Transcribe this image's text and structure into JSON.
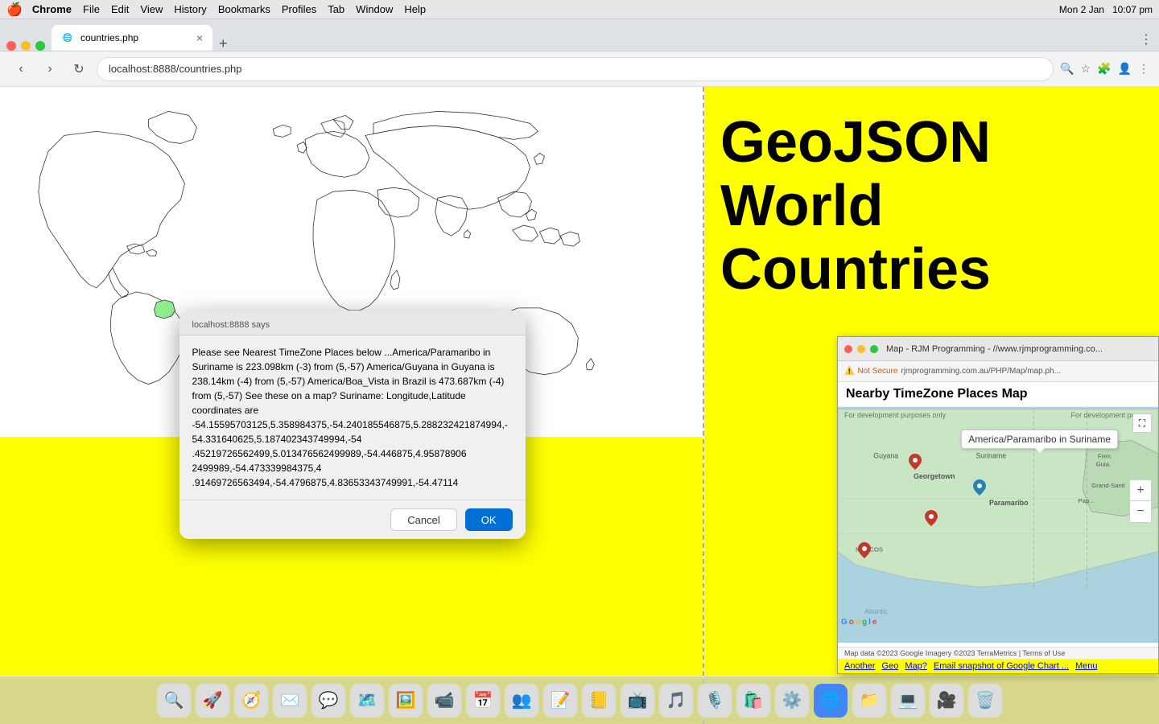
{
  "menubar": {
    "apple": "🍎",
    "items": [
      "Chrome",
      "File",
      "Edit",
      "View",
      "History",
      "Bookmarks",
      "Profiles",
      "Tab",
      "Window",
      "Help"
    ],
    "right": [
      "Mon 2 Jan",
      "10:07 pm"
    ]
  },
  "chrome": {
    "tab": {
      "title": "countries.php",
      "url": "localhost:8888/countries.php"
    },
    "new_tab_label": "+",
    "nav": {
      "back": "‹",
      "forward": "›",
      "reload": "↻"
    }
  },
  "geojson": {
    "title_line1": "GeoJSON",
    "title_line2": "World",
    "title_line3": "Countries"
  },
  "alert": {
    "origin": "localhost:8888 says",
    "body": "Please see Nearest TimeZone Places below ...America/Paramaribo in Suriname is 223.098km (-3)  from  (5,-57) America/Guyana in Guyana is 238.14km (-4)  from  (5,-57) America/Boa_Vista in Brazil is 473.687km (-4)  from  (5,-57)  See these on a map?  Suriname: Longitude,Latitude coordinates are -54.15595703125,5.358984375,-54.240185546875,5.288232421874994,-54.331640625,5.187402343749994,-54 .45219726562499,5.013476562499989,-54.446875,4.95878906 2499989,-54.473339984375,4 .91469726563494,-54.4796875,4.83653343749991,-54.47114",
    "cancel": "Cancel",
    "ok": "OK"
  },
  "floating_map": {
    "titlebar": "Map - RJM Programming - //www.rjmprogramming.co...",
    "address": "rjmprogramming.com.au/PHP/Map/map.ph...",
    "not_secure": "Not Secure",
    "header": "Nearby TimeZone Places Map",
    "tooltip": "America/Paramaribo in Suriname",
    "dev_watermark": "For development purposes only",
    "dev_watermark2": "For development purpo...",
    "footer": "Map data ©2023 Google Imagery ©2023 TerraMetrics | Terms of Use",
    "links": [
      "Another",
      "Geo",
      "Map?",
      "Email snapshot of Google Chart ...",
      "Menu"
    ],
    "places": [
      "Georgetown",
      "Paramaribo",
      "Guyana",
      "Suriname",
      "Fren. Guia.",
      "MARCOS"
    ],
    "zoom_in": "+",
    "zoom_out": "−",
    "expand": "⛶"
  }
}
